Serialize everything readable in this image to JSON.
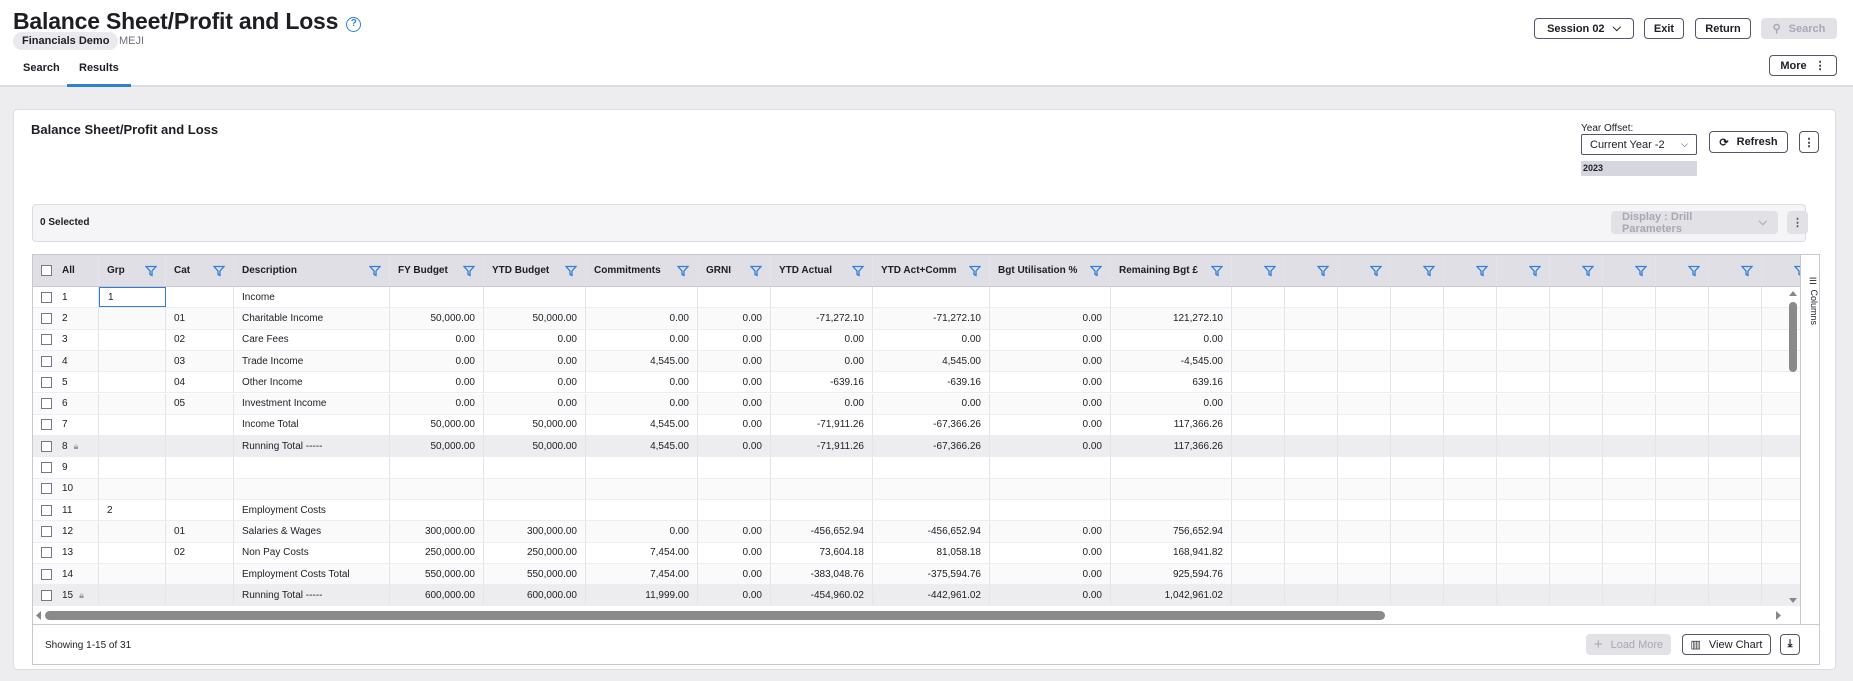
{
  "header": {
    "title": "Balance Sheet/Profit and Loss",
    "company": "Financials Demo",
    "env": "MEJI",
    "tabs": [
      "Search",
      "Results"
    ],
    "session": "Session 02",
    "exit": "Exit",
    "return": "Return",
    "search": "Search",
    "more": "More"
  },
  "card": {
    "title": "Balance Sheet/Profit and Loss",
    "year_offset_label": "Year Offset:",
    "year_offset": "Current Year -2",
    "year": "2023",
    "refresh": "Refresh",
    "selected": "0 Selected",
    "display": "Display : Drill Parameters",
    "columns_tab": "Columns"
  },
  "grid": {
    "columns": [
      "All",
      "Grp",
      "Cat",
      "Description",
      "FY Budget",
      "YTD Budget",
      "Commitments",
      "GRNI",
      "YTD Actual",
      "YTD Act+Comm",
      "Bgt Utilisation %",
      "Remaining Bgt £",
      "",
      "",
      "",
      "",
      "",
      "",
      "",
      "",
      "",
      "",
      ""
    ],
    "rows": [
      {
        "n": "1",
        "grp": "1",
        "cat": "",
        "desc": "Income",
        "v": [
          "",
          "",
          "",
          "",
          "",
          "",
          "",
          ""
        ]
      },
      {
        "n": "2",
        "grp": "",
        "cat": "01",
        "desc": "Charitable Income",
        "v": [
          "50,000.00",
          "50,000.00",
          "0.00",
          "0.00",
          "-71,272.10",
          "-71,272.10",
          "0.00",
          "121,272.10"
        ]
      },
      {
        "n": "3",
        "grp": "",
        "cat": "02",
        "desc": "Care Fees",
        "v": [
          "0.00",
          "0.00",
          "0.00",
          "0.00",
          "0.00",
          "0.00",
          "0.00",
          "0.00"
        ]
      },
      {
        "n": "4",
        "grp": "",
        "cat": "03",
        "desc": "Trade Income",
        "v": [
          "0.00",
          "0.00",
          "4,545.00",
          "0.00",
          "0.00",
          "4,545.00",
          "0.00",
          "-4,545.00"
        ]
      },
      {
        "n": "5",
        "grp": "",
        "cat": "04",
        "desc": "Other Income",
        "v": [
          "0.00",
          "0.00",
          "0.00",
          "0.00",
          "-639.16",
          "-639.16",
          "0.00",
          "639.16"
        ]
      },
      {
        "n": "6",
        "grp": "",
        "cat": "05",
        "desc": "Investment Income",
        "v": [
          "0.00",
          "0.00",
          "0.00",
          "0.00",
          "0.00",
          "0.00",
          "0.00",
          "0.00"
        ]
      },
      {
        "n": "7",
        "grp": "",
        "cat": "",
        "desc": "Income Total",
        "v": [
          "50,000.00",
          "50,000.00",
          "4,545.00",
          "0.00",
          "-71,911.26",
          "-67,366.26",
          "0.00",
          "117,366.26"
        ]
      },
      {
        "n": "8",
        "grp": "",
        "cat": "",
        "desc": "Running Total -----",
        "locked": true,
        "v": [
          "50,000.00",
          "50,000.00",
          "4,545.00",
          "0.00",
          "-71,911.26",
          "-67,366.26",
          "0.00",
          "117,366.26"
        ]
      },
      {
        "n": "9",
        "grp": "",
        "cat": "",
        "desc": "",
        "v": [
          "",
          "",
          "",
          "",
          "",
          "",
          "",
          ""
        ]
      },
      {
        "n": "10",
        "grp": "",
        "cat": "",
        "desc": "",
        "v": [
          "",
          "",
          "",
          "",
          "",
          "",
          "",
          ""
        ]
      },
      {
        "n": "11",
        "grp": "2",
        "cat": "",
        "desc": "Employment Costs",
        "v": [
          "",
          "",
          "",
          "",
          "",
          "",
          "",
          ""
        ]
      },
      {
        "n": "12",
        "grp": "",
        "cat": "01",
        "desc": "Salaries & Wages",
        "v": [
          "300,000.00",
          "300,000.00",
          "0.00",
          "0.00",
          "-456,652.94",
          "-456,652.94",
          "0.00",
          "756,652.94"
        ]
      },
      {
        "n": "13",
        "grp": "",
        "cat": "02",
        "desc": "Non Pay Costs",
        "v": [
          "250,000.00",
          "250,000.00",
          "7,454.00",
          "0.00",
          "73,604.18",
          "81,058.18",
          "0.00",
          "168,941.82"
        ]
      },
      {
        "n": "14",
        "grp": "",
        "cat": "",
        "desc": "Employment Costs Total",
        "v": [
          "550,000.00",
          "550,000.00",
          "7,454.00",
          "0.00",
          "-383,048.76",
          "-375,594.76",
          "0.00",
          "925,594.76"
        ]
      },
      {
        "n": "15",
        "grp": "",
        "cat": "",
        "desc": "Running Total -----",
        "locked": true,
        "v": [
          "600,000.00",
          "600,000.00",
          "11,999.00",
          "0.00",
          "-454,960.02",
          "-442,961.02",
          "0.00",
          "1,042,961.02"
        ]
      }
    ]
  },
  "footer": {
    "showing": "Showing 1-15 of 31",
    "load_more": "Load More",
    "view_chart": "View Chart"
  },
  "colors": {
    "accent": "#2f7fd8"
  }
}
